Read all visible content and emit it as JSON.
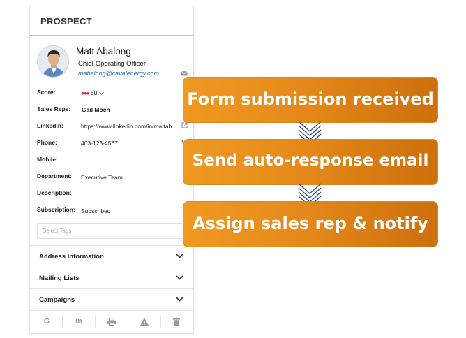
{
  "card": {
    "title": "PROSPECT",
    "name": "Matt  Abalong",
    "job_title": "Chief Operating Officer",
    "email": "mabalong@cavalenergy.com",
    "fields": {
      "score_label": "Score:",
      "score_dots": "●●●",
      "score_value": "60",
      "sales_reps_label": "Sales Reps:",
      "sales_reps_value": "Gail Moch",
      "linkedin_label": "LinkedIn:",
      "linkedin_value": "https://www.linkedin.com/in/mattab",
      "phone_label": "Phone:",
      "phone_value": "403-123-4567",
      "mobile_label": "Mobile:",
      "department_label": "Department:",
      "department_value": "Executive Team",
      "description_label": "Description:",
      "subscription_label": "Subscription:",
      "subscription_value": "Subscribed"
    },
    "tags_placeholder": "Select Tags",
    "sections": {
      "address": "Address Information",
      "mailing": "Mailing Lists",
      "campaigns": "Campaigns"
    },
    "actions": {
      "google": "G",
      "linkedin": "in"
    }
  },
  "workflow": {
    "steps": [
      "Form submission received",
      "Send auto-response email",
      "Assign sales rep & notify"
    ]
  },
  "colors": {
    "step_gradient_start": "#f09a22",
    "step_gradient_end": "#cd6f0c",
    "connector": "#2c4f8c",
    "email_link": "#2a6db5",
    "score_dots": "#e0242a"
  }
}
